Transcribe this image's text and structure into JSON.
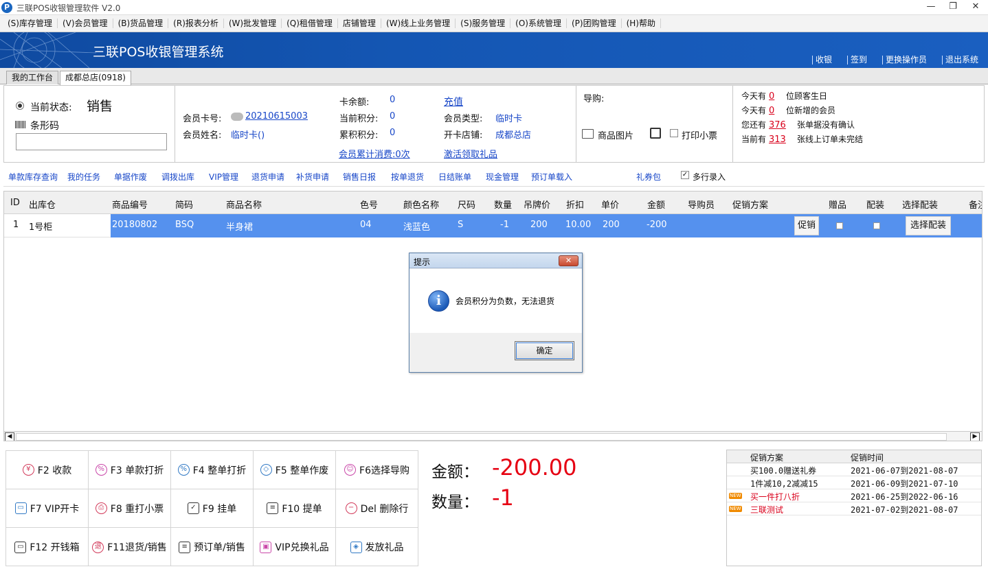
{
  "window": {
    "title": "三联POS收银管理软件 V2.0",
    "icon_letter": "P"
  },
  "menu": [
    "(S)库存管理",
    "(V)会员管理",
    "(B)货品管理",
    "(R)报表分析",
    "(W)批发管理",
    "(Q)租借管理",
    "店铺管理",
    "(W)线上业务管理",
    "(S)服务管理",
    "(O)系统管理",
    "(P)团购管理",
    "(H)帮助"
  ],
  "banner": {
    "title": "三联POS收银管理系统",
    "actions": [
      "收银",
      "签到",
      "更换操作员",
      "退出系统"
    ]
  },
  "tabs": [
    "我的工作台",
    "成都总店(0918)"
  ],
  "status": {
    "label": "当前状态:",
    "value": "销售",
    "barcode_label": "条形码",
    "barcode_value": ""
  },
  "member": {
    "card_no_label": "会员卡号:",
    "card_no": "20210615003",
    "name_label": "会员姓名:",
    "name": "临时卡()",
    "balance_label": "卡余额:",
    "balance": "0",
    "points_label": "当前积分:",
    "points": "0",
    "total_points_label": "累积积分:",
    "total_points": "0",
    "recharge": "充值",
    "type_label": "会员类型:",
    "type": "临时卡",
    "store_label": "开卡店铺:",
    "store": "成都总店",
    "consume_link": "会员累计消费:0次",
    "gift_link": "激活领取礼品"
  },
  "guide": {
    "label": "导购:",
    "product_image": "商品图片",
    "print_receipt": "打印小票"
  },
  "notices": [
    {
      "pre": "今天有",
      "num": "0",
      "post": "位顾客生日"
    },
    {
      "pre": "今天有",
      "num": "0",
      "post": "位新增的会员"
    },
    {
      "pre": "您还有",
      "num": "376",
      "post": "张单据没有确认"
    },
    {
      "pre": "当前有",
      "num": "313",
      "post": "张线上订单未完结"
    }
  ],
  "toolbar": [
    "单款库存查询",
    "我的任务",
    "单据作废",
    "调拨出库",
    "VIP管理",
    "退货申请",
    "补货申请",
    "销售日报",
    "按单退货",
    "日结账单",
    "现金管理",
    "预订单载入"
  ],
  "toolbar_extra": {
    "coupon": "礼券包",
    "multi_row": "多行录入"
  },
  "grid": {
    "columns": [
      "ID",
      "出库仓",
      "商品编号",
      "简码",
      "商品名称",
      "色号",
      "颜色名称",
      "尺码",
      "数量",
      "吊牌价",
      "折扣",
      "单价",
      "金额",
      "导购员",
      "促销方案",
      "赠品",
      "配装",
      "选择配装",
      "备注"
    ],
    "row": {
      "id": "1",
      "warehouse": "1号柜",
      "code": "20180802",
      "short": "BSQ",
      "name": "半身裙",
      "color_no": "04",
      "color_name": "浅蓝色",
      "size": "S",
      "qty": "-1",
      "tag_price": "200",
      "discount": "10.00",
      "unit_price": "200",
      "amount": "-200",
      "promo_btn": "促销",
      "select_btn": "选择配装"
    }
  },
  "dialog": {
    "title": "提示",
    "icon": "i",
    "message": "会员积分为负数，无法退货",
    "ok": "确定",
    "close": "✕"
  },
  "fkeys": [
    {
      "icon": "¥",
      "label": "F2 收款"
    },
    {
      "icon": "%",
      "label": "F3 单款打折"
    },
    {
      "icon": "%",
      "label": "F4 整单打折"
    },
    {
      "icon": "◇",
      "label": "F5 整单作废"
    },
    {
      "icon": "☺",
      "label": "F6选择导购"
    },
    {
      "icon": "▭",
      "label": "F7 VIP开卡"
    },
    {
      "icon": "⎙",
      "label": "F8 重打小票"
    },
    {
      "icon": "✓",
      "label": "F9 挂单"
    },
    {
      "icon": "≡",
      "label": "F10 提单"
    },
    {
      "icon": "−",
      "label": "Del 删除行"
    },
    {
      "icon": "▭",
      "label": "F12 开钱箱"
    },
    {
      "icon": "退",
      "label": "F11退货/销售"
    },
    {
      "icon": "≡",
      "label": "预订单/销售"
    },
    {
      "icon": "▣",
      "label": "VIP兑换礼品"
    },
    {
      "icon": "◈",
      "label": "发放礼品"
    }
  ],
  "totals": {
    "amount_label": "金额：",
    "amount": "-200.00",
    "qty_label": "数量：",
    "qty": "-1"
  },
  "promotions": {
    "headers": [
      "促销方案",
      "促销时间"
    ],
    "new_badge": "NEW",
    "rows": [
      {
        "name": "买100.0赠送礼券",
        "time": "2021-06-07到2021-08-07",
        "is_new": false
      },
      {
        "name": "1件减10,2减减15",
        "time": "2021-06-09到2021-07-10",
        "is_new": false
      },
      {
        "name": "买一件打八折",
        "time": "2021-06-25到2022-06-16",
        "is_new": true
      },
      {
        "name": "三联测试",
        "time": "2021-07-02到2021-08-07",
        "is_new": true
      }
    ]
  },
  "colors": {
    "accent": "#1746c8",
    "banner": "#1456b3",
    "row_selected": "#5591ee",
    "alert": "#e60012"
  }
}
